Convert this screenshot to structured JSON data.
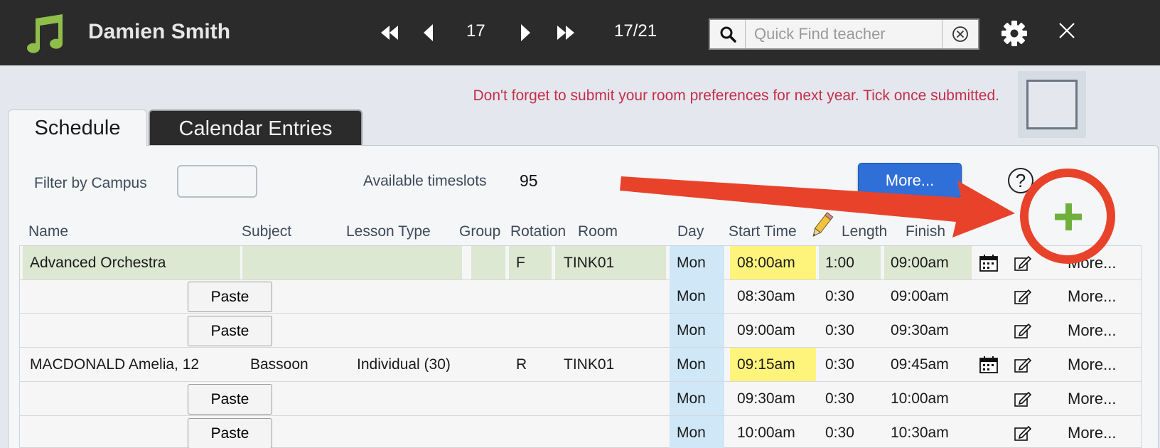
{
  "header": {
    "teacher_name": "Damien Smith",
    "record_number": "17",
    "record_position": "17/21",
    "search_placeholder": "Quick Find teacher"
  },
  "notice": {
    "text": "Don't forget to submit your room preferences for next year. Tick once submitted."
  },
  "tabs": [
    {
      "label": "Schedule",
      "active": true
    },
    {
      "label": "Calendar Entries",
      "active": false
    }
  ],
  "toolbar": {
    "filter_label": "Filter by Campus",
    "filter_value": "",
    "available_label": "Available timeslots",
    "available_value": "95",
    "more_button": "More...",
    "help_symbol": "?"
  },
  "columns": [
    "Name",
    "Subject",
    "Lesson Type",
    "Group",
    "Rotation",
    "Room",
    "Day",
    "Start Time",
    "Length",
    "Finish"
  ],
  "rows": [
    {
      "name": "Advanced Orchestra",
      "subject": "",
      "lesson_type": "",
      "group": "",
      "rotation": "F",
      "room": "TINK01",
      "day": "Mon",
      "start": "08:00am",
      "length": "1:00",
      "finish": "09:00am",
      "has_calendar": true,
      "paste": false,
      "more": "More..."
    },
    {
      "name": "",
      "subject": "",
      "lesson_type": "",
      "group": "",
      "rotation": "",
      "room": "",
      "day": "Mon",
      "start": "08:30am",
      "length": "0:30",
      "finish": "09:00am",
      "has_calendar": false,
      "paste": true,
      "paste_label": "Paste",
      "more": "More..."
    },
    {
      "name": "",
      "subject": "",
      "lesson_type": "",
      "group": "",
      "rotation": "",
      "room": "",
      "day": "Mon",
      "start": "09:00am",
      "length": "0:30",
      "finish": "09:30am",
      "has_calendar": false,
      "paste": true,
      "paste_label": "Paste",
      "more": "More..."
    },
    {
      "name": "MACDONALD Amelia, 12",
      "subject": "Bassoon",
      "lesson_type": "Individual (30)",
      "group": "",
      "rotation": "R",
      "room": "TINK01",
      "day": "Mon",
      "start": "09:15am",
      "length": "0:30",
      "finish": "09:45am",
      "has_calendar": true,
      "paste": false,
      "more": "More..."
    },
    {
      "name": "",
      "subject": "",
      "lesson_type": "",
      "group": "",
      "rotation": "",
      "room": "",
      "day": "Mon",
      "start": "09:30am",
      "length": "0:30",
      "finish": "10:00am",
      "has_calendar": false,
      "paste": true,
      "paste_label": "Paste",
      "more": "More..."
    },
    {
      "name": "",
      "subject": "",
      "lesson_type": "",
      "group": "",
      "rotation": "",
      "room": "",
      "day": "Mon",
      "start": "10:00am",
      "length": "0:30",
      "finish": "10:30am",
      "has_calendar": false,
      "paste": true,
      "paste_label": "Paste",
      "more": "More..."
    }
  ],
  "icons": {
    "logo": "music-note-icon",
    "first": "skip-back-icon",
    "prev": "previous-icon",
    "next": "next-icon",
    "last": "skip-forward-icon",
    "search": "search-icon",
    "clear": "clear-circle-x-icon",
    "settings": "gear-icon",
    "close": "close-icon",
    "edit": "pencil-icon",
    "calendar": "calendar-icon",
    "row_edit": "edit-square-icon",
    "add": "plus-icon"
  },
  "colors": {
    "topbar": "#2b2b2b",
    "logo": "#8fbe4a",
    "notice": "#c52e4a",
    "button_blue": "#2f6fd8",
    "row_green": "#dce8d2",
    "day_blue": "#cfe7f7",
    "highlight_yellow": "#fef47c",
    "annotation_red": "#e8432a",
    "plus_green": "#6fb03c"
  }
}
